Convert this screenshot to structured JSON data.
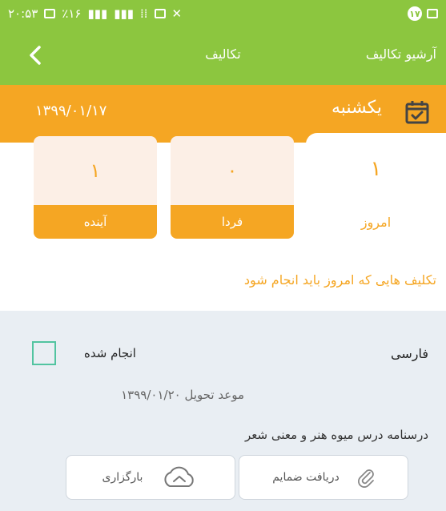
{
  "status_bar": {
    "time": "۲۰:۵۳",
    "battery": "٪۱۶",
    "notification_count": "۱۷"
  },
  "app_bar": {
    "title": "تکالیف",
    "archive_label": "آرشیو تکالیف",
    "back_icon": "chevron-left-icon"
  },
  "date_band": {
    "day_name": "یکشنبه",
    "date": "۱۳۹۹/۰۱/۱۷",
    "icon": "calendar-check-icon"
  },
  "tabs": {
    "today": {
      "label": "امروز",
      "count": "۱"
    },
    "tomorrow": {
      "label": "فردا",
      "count": "۰"
    },
    "future": {
      "label": "آینده",
      "count": "۱"
    }
  },
  "section_heading": "تکلیف هایی که امروز باید انجام شود",
  "assignment": {
    "subject": "فارسی",
    "done_label": "انجام شده",
    "deadline_label": "موعد تحویل",
    "deadline_date": "۱۳۹۹/۰۱/۲۰",
    "description": "درسنامه درس میوه هنر و معنی شعر",
    "download_label": "دریافت ضمایم",
    "upload_label": "بارگزاری"
  },
  "colors": {
    "green": "#8cc63f",
    "orange": "#f5a623",
    "card_bg": "#e9eef3",
    "checkbox_border": "#52c4a0"
  }
}
